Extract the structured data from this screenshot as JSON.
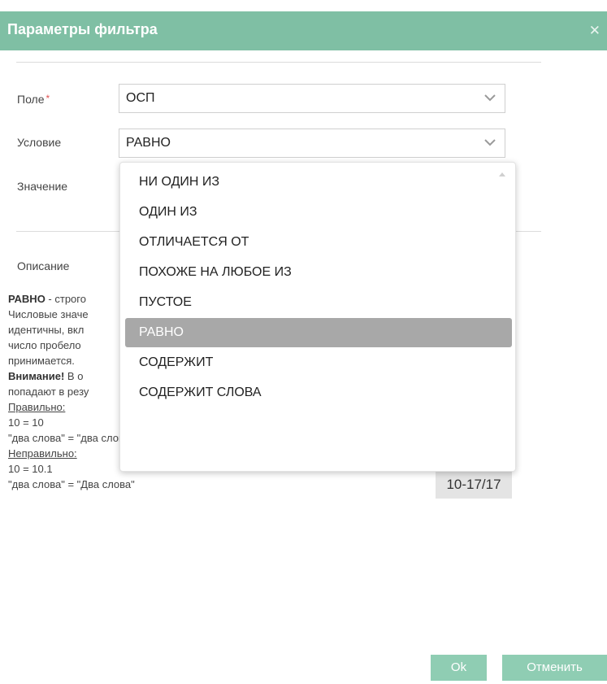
{
  "dialog": {
    "title": "Параметры фильтра",
    "close_icon": "close-icon"
  },
  "form": {
    "field_label": "Поле",
    "required_mark": "*",
    "field_value": "ОСП",
    "condition_label": "Условие",
    "condition_value": "РАВНО",
    "value_label": "Значение",
    "description_label": "Описание"
  },
  "dropdown": {
    "items": [
      "НИ ОДИН ИЗ",
      "ОДИН ИЗ",
      "ОТЛИЧАЕТСЯ ОТ",
      "ПОХОЖЕ НА ЛЮБОЕ ИЗ",
      "ПУСТОЕ",
      "РАВНО",
      "СОДЕРЖИТ",
      "СОДЕРЖИТ СЛОВА"
    ],
    "selected": "РАВНО"
  },
  "description": {
    "line1_bold": "РАВНО",
    "line1_rest": " - строго",
    "line2": "Числовые значе",
    "line3": "идентичны, вкл",
    "line4": "число пробело",
    "line5": "принимается.",
    "line6_bold": "Внимание!",
    "line6_rest": " В о",
    "line7": "попадают в резу",
    "correct_label": "Правильно:",
    "ex1": "10 = 10",
    "ex2": "\"два слова\" = \"два слова\"",
    "incorrect_label": "Неправильно:",
    "ex3": "10 = 10.1",
    "ex4": "\"два слова\" = \"Два слова\""
  },
  "badge": "10-17/17",
  "buttons": {
    "ok": "Ok",
    "cancel": "Отменить"
  }
}
